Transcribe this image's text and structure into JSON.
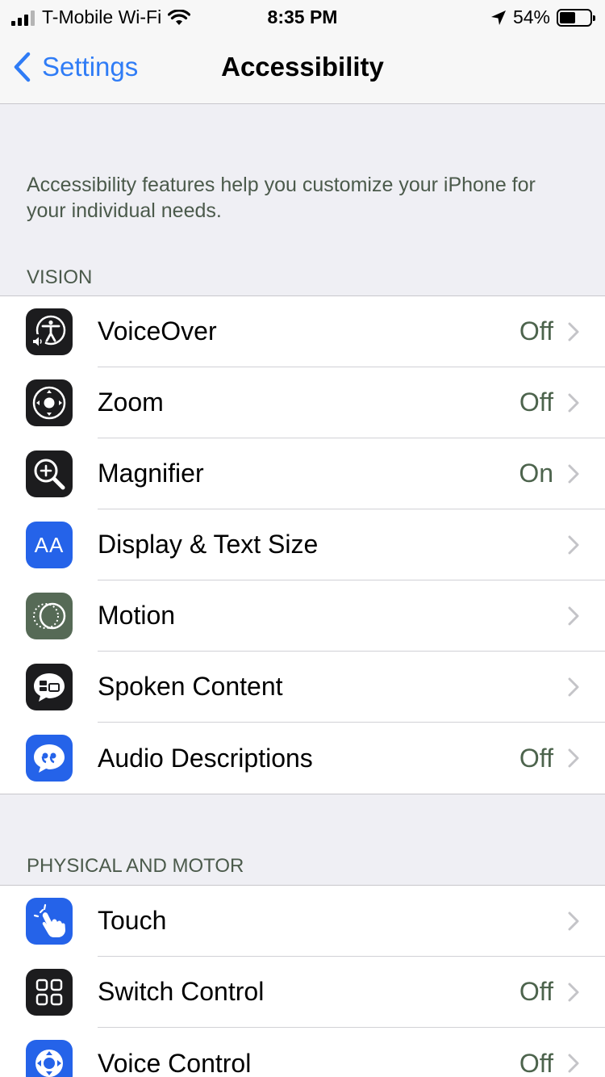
{
  "status_bar": {
    "carrier": "T-Mobile Wi-Fi",
    "time": "8:35 PM",
    "battery_percent": "54%",
    "battery_level": 0.54
  },
  "nav": {
    "back_label": "Settings",
    "title": "Accessibility"
  },
  "intro_text": "Accessibility features help you customize your iPhone for your individual needs.",
  "vision": {
    "header": "VISION",
    "items": [
      {
        "label": "VoiceOver",
        "value": "Off",
        "icon": "voiceover-icon"
      },
      {
        "label": "Zoom",
        "value": "Off",
        "icon": "zoom-icon"
      },
      {
        "label": "Magnifier",
        "value": "On",
        "icon": "magnifier-icon"
      },
      {
        "label": "Display & Text Size",
        "value": "",
        "icon": "text-size-icon",
        "icon_text": "AA"
      },
      {
        "label": "Motion",
        "value": "",
        "icon": "motion-icon"
      },
      {
        "label": "Spoken Content",
        "value": "",
        "icon": "spoken-content-icon"
      },
      {
        "label": "Audio Descriptions",
        "value": "Off",
        "icon": "audio-descriptions-icon"
      }
    ]
  },
  "physical": {
    "header": "PHYSICAL AND MOTOR",
    "items": [
      {
        "label": "Touch",
        "value": "",
        "icon": "touch-icon"
      },
      {
        "label": "Switch Control",
        "value": "Off",
        "icon": "switch-control-icon"
      },
      {
        "label": "Voice Control",
        "value": "Off",
        "icon": "voice-control-icon"
      }
    ]
  },
  "colors": {
    "accent": "#2f7cf6",
    "value_text": "#4d644d",
    "icon_dark": "#1c1c1e",
    "icon_blue": "#2563e9",
    "icon_green": "#566a56"
  }
}
